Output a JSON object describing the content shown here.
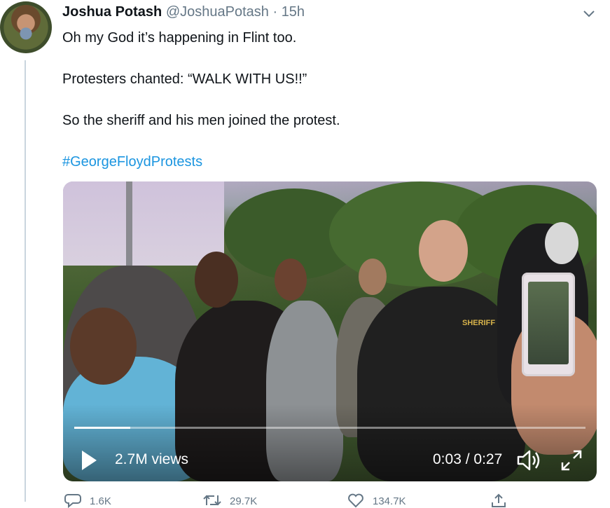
{
  "author": {
    "name": "Joshua Potash",
    "handle": "@JoshuaPotash",
    "separator": "·",
    "time": "15h"
  },
  "tweet": {
    "lines": [
      "Oh my God it’s happening in Flint too.",
      "Protesters chanted: “WALK WITH US!!”",
      "So the sheriff and his men joined the protest."
    ],
    "hashtag": "#GeorgeFloydProtests"
  },
  "video": {
    "views": "2.7M views",
    "current_time": "0:03",
    "time_separator": "/",
    "duration": "0:27",
    "progress_fraction": 0.11,
    "shirt_text": "SHERIFF"
  },
  "actions": {
    "reply_count": "1.6K",
    "retweet_count": "29.7K",
    "like_count": "134.7K"
  },
  "icons": {
    "menu": "chevron-down-icon",
    "play": "play-icon",
    "volume": "volume-icon",
    "fullscreen": "fullscreen-icon",
    "reply": "reply-icon",
    "retweet": "retweet-icon",
    "like": "heart-icon",
    "share": "share-icon"
  },
  "colors": {
    "link": "#1b95e0",
    "muted": "#657786",
    "text": "#0f1419"
  }
}
